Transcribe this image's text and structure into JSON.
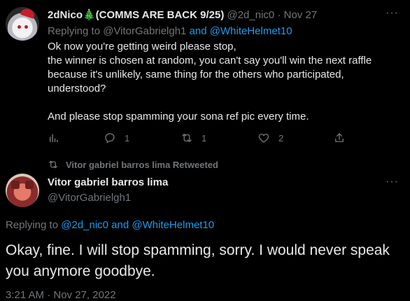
{
  "tweet1": {
    "display_name": "2dNico🎄(COMMS ARE BACK 9/25)",
    "handle": "@2d_nic0",
    "separator": "·",
    "date": "Nov 27",
    "more": "···",
    "replying_prefix": "Replying to",
    "replying_user1": "@VitorGabrielgh1",
    "replying_and": "and",
    "replying_user2": "@WhiteHelmet10",
    "body_lines": [
      "Ok now you're getting weird please stop,",
      "the winner is chosen at random, you can't say you'll win the next raffle",
      "because it's unlikely, same thing for the others who participated,",
      "understood?",
      "",
      "And please stop spamming your sona ref pic every time."
    ],
    "replies": "1",
    "retweets": "1",
    "likes": "2"
  },
  "retweet_label": "Vitor gabriel barros lima Retweeted",
  "tweet2": {
    "display_name": "Vitor gabriel barros lima",
    "handle": "@VitorGabrielgh1",
    "more": "···",
    "replying_prefix": "Replying to",
    "replying_user1": "@2d_nic0",
    "replying_and": "and",
    "replying_user2": "@WhiteHelmet10",
    "body": "Okay, fine. I will stop spamming, sorry. I would never speak you anymore goodbye.",
    "timestamp": "3:21 AM · Nov 27, 2022"
  },
  "colors": {
    "background": "#000000",
    "text": "#e7e9ea",
    "muted": "#71767b",
    "link": "#1d9bf0"
  },
  "icons": [
    "stats-icon",
    "reply-icon",
    "retweet-icon",
    "like-icon",
    "share-icon",
    "more-icon"
  ]
}
